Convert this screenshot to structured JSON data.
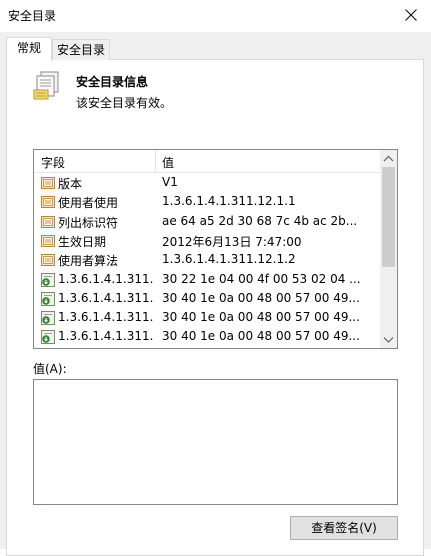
{
  "window": {
    "title": "安全目录"
  },
  "tabs": [
    {
      "label": "常规",
      "active": true
    },
    {
      "label": "安全目录",
      "active": false
    }
  ],
  "info": {
    "title": "安全目录信息",
    "subtitle": "该安全目录有效。"
  },
  "list": {
    "columns": [
      "字段",
      "值"
    ],
    "rows": [
      {
        "icon": "property-icon",
        "name": "版本",
        "value": "V1"
      },
      {
        "icon": "property-icon",
        "name": "使用者使用",
        "value": "1.3.6.1.4.1.311.12.1.1"
      },
      {
        "icon": "property-icon",
        "name": "列出标识符",
        "value": "ae 64 a5 2d 30 68 7c 4b ac 2b..."
      },
      {
        "icon": "property-icon",
        "name": "生效日期",
        "value": "2012年6月13日 7:47:00"
      },
      {
        "icon": "property-icon",
        "name": "使用者算法",
        "value": "1.3.6.1.4.1.311.12.1.2"
      },
      {
        "icon": "extension-icon",
        "name": "1.3.6.1.4.1.311.1...",
        "value": "30 22 1e 04 00 4f 00 53 02 04 ..."
      },
      {
        "icon": "extension-icon",
        "name": "1.3.6.1.4.1.311.1...",
        "value": "30 40 1e 0a 00 48 00 57 00 49..."
      },
      {
        "icon": "extension-icon",
        "name": "1.3.6.1.4.1.311.1...",
        "value": "30 40 1e 0a 00 48 00 57 00 49..."
      },
      {
        "icon": "extension-icon",
        "name": "1.3.6.1.4.1.311.1...",
        "value": "30 40 1e 0a 00 48 00 57 00 49..."
      }
    ]
  },
  "value_field": {
    "label": "值(A):",
    "value": ""
  },
  "buttons": {
    "view_signature": "查看签名(V)"
  },
  "colors": {
    "panel_border": "#d9d9d9",
    "list_border": "#828790",
    "window_bg": "#f0f0f0"
  }
}
